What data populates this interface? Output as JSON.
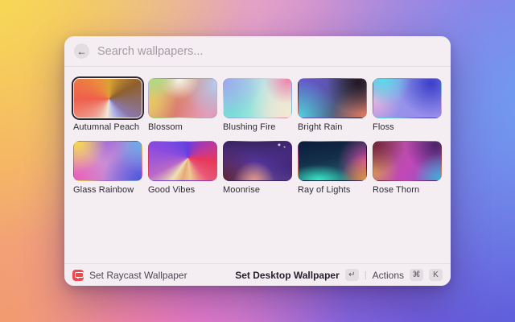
{
  "search": {
    "placeholder": "Search wallpapers...",
    "back_icon": "←"
  },
  "selected_wallpaper": "Autumnal Peach",
  "wallpapers": [
    {
      "name": "Autumnal Peach",
      "selected": true,
      "gradient": "conic-gradient(from 0deg at 52% 52%, #d9a232, #8f5f2e 17%, #8b78ab 36%, #aab2e8 44%, #f2e7d2 52%, #eda899 60%, #ef5f4c 75%, #ec8a3e 90%, #d9a232)"
    },
    {
      "name": "Blossom",
      "selected": false,
      "gradient": "radial-gradient(circle at 10% 0%, #a8dc82 0%, rgba(168,220,130,0) 30%), radial-gradient(circle at 45% 0%, #f4f6ec 0%, rgba(244,246,236,0) 38%), radial-gradient(circle at 100% 15%, #b4ccf2 0%, rgba(180,204,242,0) 45%), radial-gradient(circle at 0% 60%, #e8c95e 0%, rgba(232,201,94,0) 40%), radial-gradient(circle at 85% 100%, #e89ab8 0%, rgba(232,154,184,0) 50%), radial-gradient(circle at 45% 85%, #da7a68 0%, rgba(218,122,104,0) 55%), linear-gradient(135deg, #e8cf90, #d98a78 55%, #cf8ea8)"
    },
    {
      "name": "Blushing Fire",
      "selected": false,
      "gradient": "radial-gradient(circle at 95% 3%, #ef86ae 0%, rgba(239,134,174,0) 32%), radial-gradient(circle at 100% 85%, #f2e9d0 0%, rgba(242,233,208,0) 55%), radial-gradient(circle at 0% 8%, #9daaec 0%, rgba(157,170,236,0) 50%), radial-gradient(circle at 10% 85%, #72e4d4 0%, rgba(114,228,212,0) 60%), linear-gradient(120deg, #9fc8ec, #bfe4e2 50%, #e8e4da)"
    },
    {
      "name": "Bright Rain",
      "selected": false,
      "gradient": "radial-gradient(circle at 88% 8%, #241622 0%, rgba(36,22,34,0) 45%), radial-gradient(circle at 100% 100%, #e07a60 0%, rgba(224,122,96,0) 45%), radial-gradient(circle at 0% 100%, #52d4de 0%, rgba(82,212,222,0) 50%), radial-gradient(circle at 10% 0%, #6657c8 0%, rgba(102,87,200,0) 60%), linear-gradient(135deg, #5a50b8, #4a5878 60%, #7a5a64)"
    },
    {
      "name": "Floss",
      "selected": false,
      "gradient": "radial-gradient(circle at 15% 0%, #58dcea 0%, rgba(88,220,234,0) 40%), radial-gradient(circle at 85% 12%, #3a3ec9 0%, rgba(58,62,201,0) 50%), radial-gradient(circle at 0% 55%, #eeb2dc 0%, rgba(238,178,220,0) 40%), linear-gradient(160deg, #8e9ae8, #9b8cec)"
    },
    {
      "name": "Glass Rainbow",
      "selected": false,
      "gradient": "radial-gradient(circle at 4% 0%, #f4d94c 0%, rgba(244,217,76,0) 40%), radial-gradient(circle at 45% -12%, #9a66dc 0%, rgba(154,102,220,0) 45%), radial-gradient(circle at 100% 0%, #64aeea 0%, rgba(100,174,234,0) 40%), radial-gradient(circle at 0% 100%, #ea5cb8 0%, rgba(234,92,184,0) 45%), radial-gradient(circle at 100% 100%, #4a58dd 0%, rgba(74,88,221,0) 50%), linear-gradient(120deg, #e8a0c8, #a87ae0)"
    },
    {
      "name": "Good Vibes",
      "selected": false,
      "gradient": "conic-gradient(from 0deg at 58% 42%, #6a3ae0 0%, #c03898 18%, #e83858 27%, #e85878 38%, #f0c890 48%, #e8a878 54%, #f0e0b0 60%, #b868c8 68%, #8a4ae0 80%, #6a48e0 92%, #6a3ae0 100%)"
    },
    {
      "name": "Moonrise",
      "selected": false,
      "gradient": "radial-gradient(circle 1.5px at 82% 8%, #d8cef0 98%, rgba(216,206,240,0) 100%), radial-gradient(circle 1px at 90% 14%, #c8bce8 98%, rgba(200,188,232,0) 100%), radial-gradient(circle at 45% 105%, #eda288 0%, rgba(237,162,136,0) 38%), radial-gradient(circle at 0% 100%, #5c2438 0%, rgba(92,36,56,0) 45%), radial-gradient(circle at 100% 60%, #42287a 0%, rgba(66,40,122,0) 50%), linear-gradient(180deg, #3a2462 0%, #55359c 55%, #6a4a9a 100%)"
    },
    {
      "name": "Ray of Lights",
      "selected": false,
      "gradient": "radial-gradient(ellipse 80% 65% at 30% 100%, #35ecc8 0%, rgba(53,236,200,0) 62%), radial-gradient(circle at 102% 102%, #e8983a 0%, rgba(232,152,58,0) 35%), radial-gradient(circle at 102% 55%, #d848a8 0%, rgba(216,72,168,0) 42%), linear-gradient(170deg, #0c1c3c 0%, #13304a 45%, #2a6878 100%)"
    },
    {
      "name": "Rose Thorn",
      "selected": false,
      "gradient": "radial-gradient(circle at 0% 0%, #6e2132 0%, rgba(110,33,50,0) 42%), radial-gradient(circle at 0% 72%, #dc9858 0%, rgba(220,152,88,0) 35%), radial-gradient(circle at 100% 100%, #3ab4d8 0%, rgba(58,180,216,0) 35%), radial-gradient(circle at 92% 8%, #4a2468 0%, rgba(74,36,104,0) 42%), linear-gradient(120deg, #b05888, #c048b8 55%, #8858c8)"
    }
  ],
  "footer": {
    "left_action": "Set Raycast Wallpaper",
    "primary_action": "Set Desktop Wallpaper",
    "primary_key": "↵",
    "divider": "|",
    "actions_label": "Actions",
    "cmd_key": "⌘",
    "k_key": "K"
  },
  "colors": {
    "window_bg": "#f4eef2",
    "separator": "#e4dde2",
    "selection_ring": "#2e2733",
    "raycast_red": "#f0484f",
    "key_badge_bg": "#e3dce1",
    "placeholder_text": "#a49aa6",
    "label_text": "#2e2936"
  }
}
